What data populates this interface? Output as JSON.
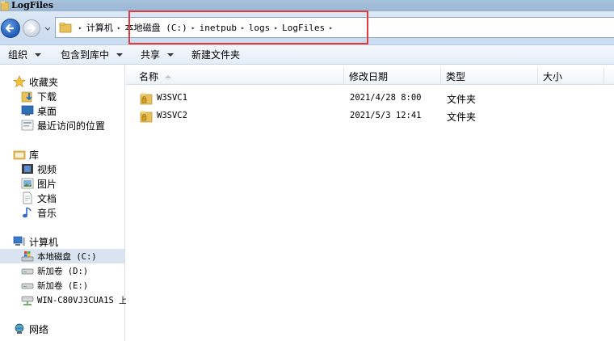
{
  "window": {
    "title": "LogFiles"
  },
  "address": {
    "crumbs": [
      "计算机",
      "本地磁盘 (C:)",
      "inetpub",
      "logs",
      "LogFiles"
    ]
  },
  "toolbar": {
    "organize": "组织",
    "include_in_library": "包含到库中",
    "share": "共享",
    "new_folder": "新建文件夹"
  },
  "sidebar": {
    "favorites": {
      "label": "收藏夹",
      "items": [
        "下载",
        "桌面",
        "最近访问的位置"
      ]
    },
    "libraries": {
      "label": "库",
      "items": [
        "视频",
        "图片",
        "文档",
        "音乐"
      ]
    },
    "computer": {
      "label": "计算机",
      "drives": [
        "本地磁盘 (C:)",
        "新加卷 (D:)",
        "新加卷 (E:)",
        "WIN-C80VJ3CUA1S 上"
      ]
    },
    "network": {
      "label": "网络"
    }
  },
  "columns": {
    "name": "名称",
    "modified": "修改日期",
    "type": "类型",
    "size": "大小"
  },
  "files": [
    {
      "name": "W3SVC1",
      "modified": "2021/4/28 8:00",
      "type": "文件夹"
    },
    {
      "name": "W3SVC2",
      "modified": "2021/5/3 12:41",
      "type": "文件夹"
    }
  ],
  "colors": {
    "highlight": "#e23b3b",
    "selection": "#d9e4f0"
  }
}
